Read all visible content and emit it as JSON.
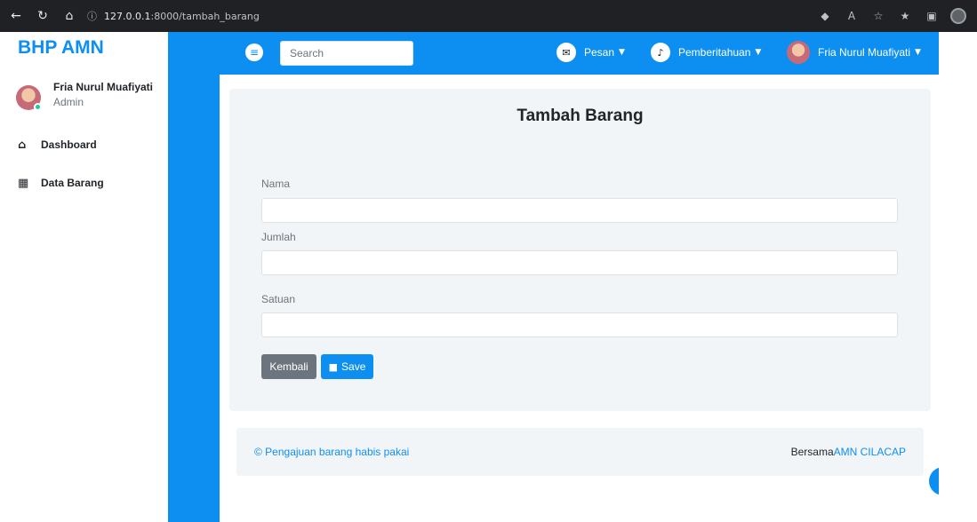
{
  "browser": {
    "url_host": "127.0.0.1",
    "url_path": ":8000/tambah_barang",
    "info_icon": "info-icon"
  },
  "sidebar": {
    "brand": "BHP AMN",
    "profile": {
      "name": "Fria Nurul Muafiyati",
      "role": "Admin"
    },
    "items": [
      {
        "label": "Dashboard",
        "icon": "home-icon"
      },
      {
        "label": "Data Barang",
        "icon": "grid-icon"
      }
    ]
  },
  "topbar": {
    "search_placeholder": "Search",
    "messages_label": "Pesan",
    "notifications_label": "Pemberitahuan",
    "user_label": "Fria Nurul Muafiyati"
  },
  "form": {
    "title": "Tambah Barang",
    "fields": [
      {
        "label": "Nama",
        "value": ""
      },
      {
        "label": "Jumlah",
        "value": ""
      },
      {
        "label": "Satuan",
        "value": ""
      }
    ],
    "back_label": "Kembali",
    "save_label": "Save"
  },
  "footer": {
    "left_text": "© Pengajuan barang habis pakai",
    "right_prefix": "Bersama",
    "right_link": "AMN CILACAP"
  },
  "colors": {
    "accent": "#0d8ff2",
    "secondary_button": "#6c757d",
    "card_background": "#f2f5f8"
  }
}
